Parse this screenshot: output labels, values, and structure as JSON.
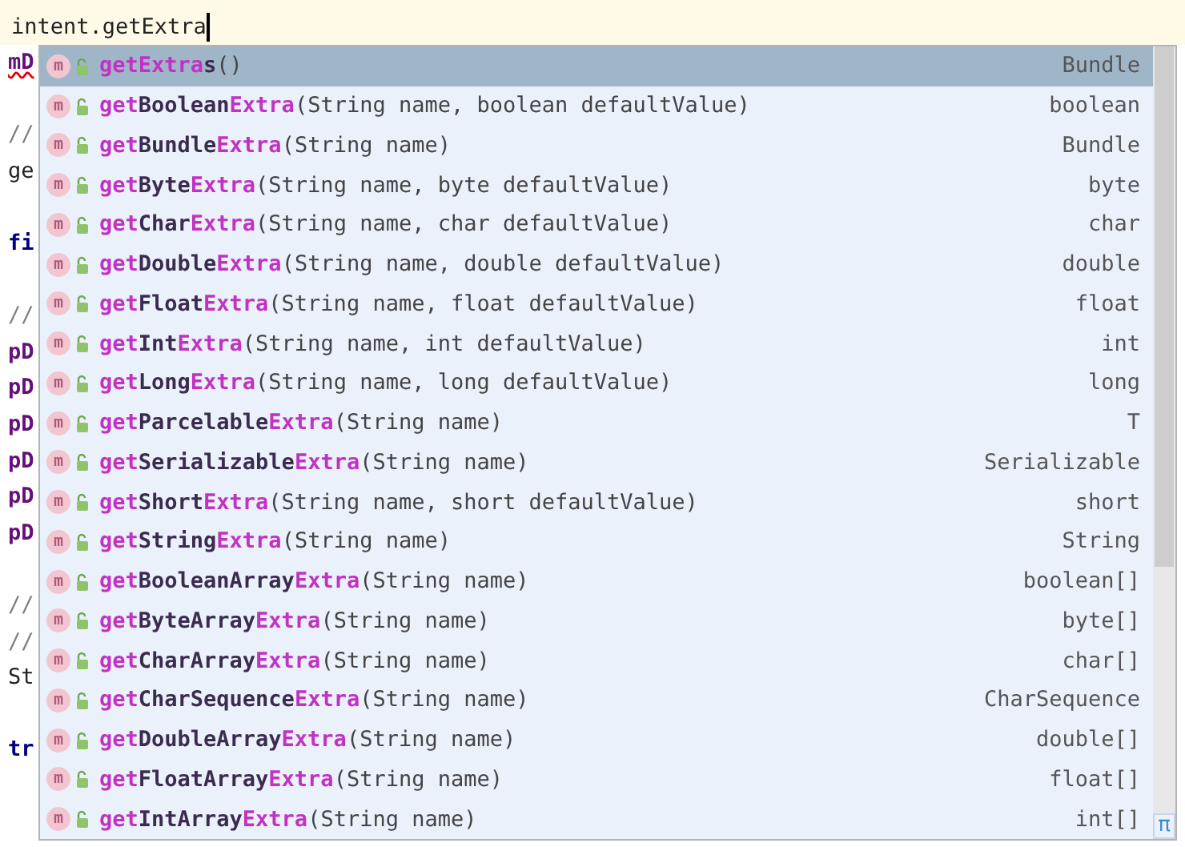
{
  "editor": {
    "current_line": "intent.getExtra",
    "code_lines": [
      {
        "text": "mD",
        "kind": "field",
        "error": true
      },
      {
        "kind": "blank"
      },
      {
        "text": "//",
        "kind": "comment"
      },
      {
        "text": "ge",
        "kind": "code"
      },
      {
        "kind": "blank"
      },
      {
        "text": "fi",
        "kind": "keyword"
      },
      {
        "kind": "blank"
      },
      {
        "text": "//",
        "kind": "comment"
      },
      {
        "text": "pD",
        "kind": "field"
      },
      {
        "text": "pD",
        "kind": "field"
      },
      {
        "text": "pD",
        "kind": "field"
      },
      {
        "text": "pD",
        "kind": "field"
      },
      {
        "text": "pD",
        "kind": "field"
      },
      {
        "text": "pD",
        "kind": "field"
      },
      {
        "kind": "blank"
      },
      {
        "text": "//",
        "kind": "comment"
      },
      {
        "text": "//",
        "kind": "comment"
      },
      {
        "text": "St",
        "kind": "code"
      },
      {
        "kind": "blank"
      },
      {
        "text": "tr",
        "kind": "keyword"
      }
    ]
  },
  "completion": {
    "corner_symbol": "π",
    "items": [
      {
        "badge": "m",
        "name": [
          {
            "t": "get",
            "match": true
          },
          {
            "t": "Extra",
            "match": true
          },
          {
            "t": "s",
            "match": false
          }
        ],
        "params": "()",
        "type": "Bundle",
        "selected": true
      },
      {
        "badge": "m",
        "name": [
          {
            "t": "get",
            "match": true
          },
          {
            "t": "Boolean",
            "match": false
          },
          {
            "t": "Extra",
            "match": true
          }
        ],
        "params": "(String name, boolean defaultValue)",
        "type": "boolean",
        "selected": false
      },
      {
        "badge": "m",
        "name": [
          {
            "t": "get",
            "match": true
          },
          {
            "t": "Bundle",
            "match": false
          },
          {
            "t": "Extra",
            "match": true
          }
        ],
        "params": "(String name)",
        "type": "Bundle",
        "selected": false
      },
      {
        "badge": "m",
        "name": [
          {
            "t": "get",
            "match": true
          },
          {
            "t": "Byte",
            "match": false
          },
          {
            "t": "Extra",
            "match": true
          }
        ],
        "params": "(String name, byte defaultValue)",
        "type": "byte",
        "selected": false
      },
      {
        "badge": "m",
        "name": [
          {
            "t": "get",
            "match": true
          },
          {
            "t": "Char",
            "match": false
          },
          {
            "t": "Extra",
            "match": true
          }
        ],
        "params": "(String name, char defaultValue)",
        "type": "char",
        "selected": false
      },
      {
        "badge": "m",
        "name": [
          {
            "t": "get",
            "match": true
          },
          {
            "t": "Double",
            "match": false
          },
          {
            "t": "Extra",
            "match": true
          }
        ],
        "params": "(String name, double defaultValue)",
        "type": "double",
        "selected": false
      },
      {
        "badge": "m",
        "name": [
          {
            "t": "get",
            "match": true
          },
          {
            "t": "Float",
            "match": false
          },
          {
            "t": "Extra",
            "match": true
          }
        ],
        "params": "(String name, float defaultValue)",
        "type": "float",
        "selected": false
      },
      {
        "badge": "m",
        "name": [
          {
            "t": "get",
            "match": true
          },
          {
            "t": "Int",
            "match": false
          },
          {
            "t": "Extra",
            "match": true
          }
        ],
        "params": "(String name, int defaultValue)",
        "type": "int",
        "selected": false
      },
      {
        "badge": "m",
        "name": [
          {
            "t": "get",
            "match": true
          },
          {
            "t": "Long",
            "match": false
          },
          {
            "t": "Extra",
            "match": true
          }
        ],
        "params": "(String name, long defaultValue)",
        "type": "long",
        "selected": false
      },
      {
        "badge": "m",
        "name": [
          {
            "t": "get",
            "match": true
          },
          {
            "t": "Parcelable",
            "match": false
          },
          {
            "t": "Extra",
            "match": true
          }
        ],
        "params": "(String name)",
        "type": "T",
        "selected": false
      },
      {
        "badge": "m",
        "name": [
          {
            "t": "get",
            "match": true
          },
          {
            "t": "Serializable",
            "match": false
          },
          {
            "t": "Extra",
            "match": true
          }
        ],
        "params": "(String name)",
        "type": "Serializable",
        "selected": false
      },
      {
        "badge": "m",
        "name": [
          {
            "t": "get",
            "match": true
          },
          {
            "t": "Short",
            "match": false
          },
          {
            "t": "Extra",
            "match": true
          }
        ],
        "params": "(String name, short defaultValue)",
        "type": "short",
        "selected": false
      },
      {
        "badge": "m",
        "name": [
          {
            "t": "get",
            "match": true
          },
          {
            "t": "String",
            "match": false
          },
          {
            "t": "Extra",
            "match": true
          }
        ],
        "params": "(String name)",
        "type": "String",
        "selected": false
      },
      {
        "badge": "m",
        "name": [
          {
            "t": "get",
            "match": true
          },
          {
            "t": "BooleanArray",
            "match": false
          },
          {
            "t": "Extra",
            "match": true
          }
        ],
        "params": "(String name)",
        "type": "boolean[]",
        "selected": false
      },
      {
        "badge": "m",
        "name": [
          {
            "t": "get",
            "match": true
          },
          {
            "t": "ByteArray",
            "match": false
          },
          {
            "t": "Extra",
            "match": true
          }
        ],
        "params": "(String name)",
        "type": "byte[]",
        "selected": false
      },
      {
        "badge": "m",
        "name": [
          {
            "t": "get",
            "match": true
          },
          {
            "t": "CharArray",
            "match": false
          },
          {
            "t": "Extra",
            "match": true
          }
        ],
        "params": "(String name)",
        "type": "char[]",
        "selected": false
      },
      {
        "badge": "m",
        "name": [
          {
            "t": "get",
            "match": true
          },
          {
            "t": "CharSequence",
            "match": false
          },
          {
            "t": "Extra",
            "match": true
          }
        ],
        "params": "(String name)",
        "type": "CharSequence",
        "selected": false
      },
      {
        "badge": "m",
        "name": [
          {
            "t": "get",
            "match": true
          },
          {
            "t": "DoubleArray",
            "match": false
          },
          {
            "t": "Extra",
            "match": true
          }
        ],
        "params": "(String name)",
        "type": "double[]",
        "selected": false
      },
      {
        "badge": "m",
        "name": [
          {
            "t": "get",
            "match": true
          },
          {
            "t": "FloatArray",
            "match": false
          },
          {
            "t": "Extra",
            "match": true
          }
        ],
        "params": "(String name)",
        "type": "float[]",
        "selected": false
      },
      {
        "badge": "m",
        "name": [
          {
            "t": "get",
            "match": true
          },
          {
            "t": "IntArray",
            "match": false
          },
          {
            "t": "Extra",
            "match": true
          }
        ],
        "params": "(String name)",
        "type": "int[]",
        "selected": false
      }
    ]
  }
}
